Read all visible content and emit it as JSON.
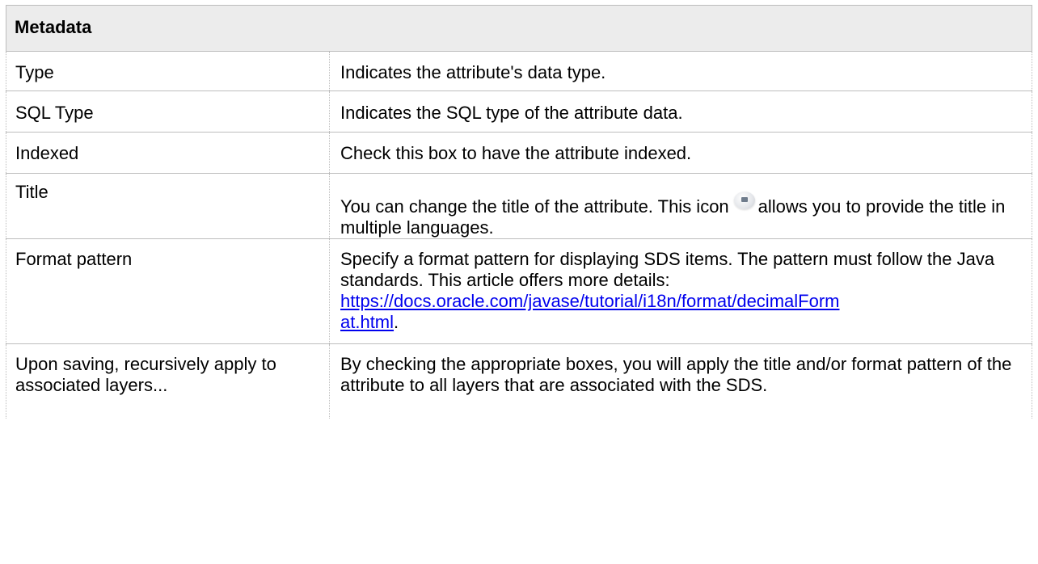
{
  "table": {
    "header": "Metadata",
    "rows": {
      "type": {
        "key": "Type",
        "desc": "Indicates the attribute's data type."
      },
      "sql_type": {
        "key": "SQL Type",
        "desc": "Indicates the SQL type of the attribute data."
      },
      "indexed": {
        "key": "Indexed",
        "desc": "Check this box to have the attribute indexed."
      },
      "title": {
        "key": "Title",
        "desc_before": "You can change the title of the attribute. This icon",
        "icon": "language-globe-icon",
        "desc_after": "allows you to provide the title in multiple languages."
      },
      "format_pattern": {
        "key": "Format pattern",
        "desc": "Specify a format pattern for displaying SDS items. The pattern must follow the Java standards. This article offers more details:",
        "link_part1": "https://docs.oracle.com/javase/tutorial/i18n/format/decimalForm",
        "link_part2": "at.html",
        "desc_end": "."
      },
      "upon_saving": {
        "key": "Upon saving, recursively apply to associated layers...",
        "desc": "By checking the appropriate boxes, you will apply the title and/or format pattern of the attribute to all layers that are associated with the SDS."
      }
    }
  }
}
